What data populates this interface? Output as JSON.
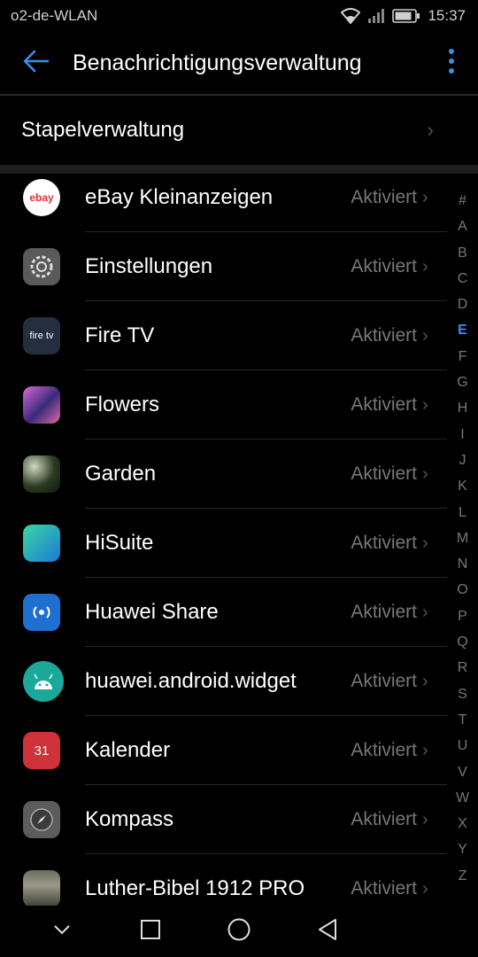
{
  "status": {
    "carrier": "o2-de-WLAN",
    "time": "15:37",
    "icons": [
      "wifi-icon",
      "signal-icon",
      "battery-icon"
    ]
  },
  "header": {
    "title": "Benachrichtigungsverwaltung",
    "back_icon": "arrow-back-icon",
    "menu_icon": "more-vert-icon"
  },
  "batch": {
    "label": "Stapelverwaltung"
  },
  "apps": [
    {
      "name": "eBay Kleinanzeigen",
      "state": "Aktiviert",
      "icon": "ebay-kleinanzeigen-icon"
    },
    {
      "name": "Einstellungen",
      "state": "Aktiviert",
      "icon": "settings-gear-icon"
    },
    {
      "name": "Fire TV",
      "state": "Aktiviert",
      "icon": "fire-tv-icon"
    },
    {
      "name": "Flowers",
      "state": "Aktiviert",
      "icon": "flowers-icon"
    },
    {
      "name": "Garden",
      "state": "Aktiviert",
      "icon": "garden-icon"
    },
    {
      "name": "HiSuite",
      "state": "Aktiviert",
      "icon": "hisuite-icon"
    },
    {
      "name": "Huawei Share",
      "state": "Aktiviert",
      "icon": "huawei-share-icon"
    },
    {
      "name": "huawei.android.widget",
      "state": "Aktiviert",
      "icon": "android-icon"
    },
    {
      "name": "Kalender",
      "state": "Aktiviert",
      "icon": "calendar-icon"
    },
    {
      "name": "Kompass",
      "state": "Aktiviert",
      "icon": "compass-icon"
    },
    {
      "name": "Luther-Bibel 1912 PRO",
      "state": "Aktiviert",
      "icon": "bible-icon"
    }
  ],
  "alphabet": {
    "letters": [
      "#",
      "A",
      "B",
      "C",
      "D",
      "E",
      "F",
      "G",
      "H",
      "I",
      "J",
      "K",
      "L",
      "M",
      "N",
      "O",
      "P",
      "Q",
      "R",
      "S",
      "T",
      "U",
      "V",
      "W",
      "X",
      "Y",
      "Z"
    ],
    "active": "E"
  },
  "calendar_day": "31",
  "ebay_text": "ebay",
  "firetv_text": "fire tv",
  "colors": {
    "accent": "#3b8ee6",
    "background": "#000000",
    "secondary_text": "#777777"
  }
}
